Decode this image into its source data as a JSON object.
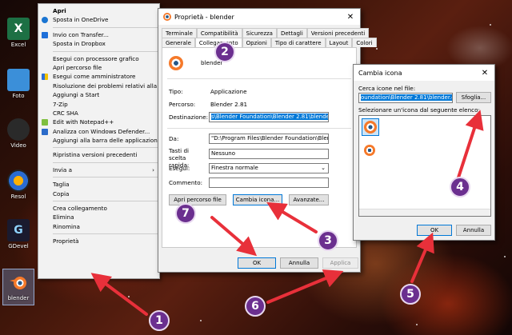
{
  "desktop": {
    "icons": [
      {
        "label": "Excel"
      },
      {
        "label": "Foto"
      },
      {
        "label": "Video"
      },
      {
        "label": "Resol"
      },
      {
        "label": "GDevel"
      },
      {
        "label": "blender"
      }
    ]
  },
  "context_menu": {
    "items": [
      {
        "label": "Apri"
      },
      {
        "label": "Sposta in OneDrive"
      },
      {
        "label": "Invio con Transfer..."
      },
      {
        "label": "Sposta in Dropbox"
      },
      {
        "label": "Esegui con processore grafico"
      },
      {
        "label": "Apri percorso file"
      },
      {
        "label": "Esegui come amministratore"
      },
      {
        "label": "Risoluzione dei problemi relativi alla co"
      },
      {
        "label": "Aggiungi a Start"
      },
      {
        "label": "7-Zip"
      },
      {
        "label": "CRC SHA"
      },
      {
        "label": "Edit with Notepad++"
      },
      {
        "label": "Analizza con Windows Defender..."
      },
      {
        "label": "Aggiungi alla barra delle applicazioni"
      },
      {
        "label": "Ripristina versioni precedenti"
      },
      {
        "label": "Invia a"
      },
      {
        "label": "Taglia"
      },
      {
        "label": "Copia"
      },
      {
        "label": "Crea collegamento"
      },
      {
        "label": "Elimina"
      },
      {
        "label": "Rinomina"
      },
      {
        "label": "Proprietà"
      }
    ]
  },
  "properties": {
    "title": "Proprietà - blender",
    "close_glyph": "✕",
    "tabs_row1": [
      "Terminale",
      "Compatibilità",
      "Sicurezza",
      "Dettagli",
      "Versioni precedenti"
    ],
    "tabs_row2": [
      "Generale",
      "Collegamento",
      "Opzioni",
      "Tipo di carattere",
      "Layout",
      "Colori"
    ],
    "name": "blender",
    "labels": {
      "tipo": "Tipo:",
      "percorso": "Percorso:",
      "destinazione": "Destinazione:",
      "da": "Da:",
      "tasti": "Tasti di scelta rapida:",
      "esegui": "Esegui:",
      "commento": "Commento:"
    },
    "values": {
      "tipo": "Applicazione",
      "percorso": "Blender 2.81",
      "destinazione": "s\\Blender Foundation\\Blender 2.81\\blender.exe\"",
      "da": "\"D:\\Program Files\\Blender Foundation\\Blender 2.",
      "tasti": "Nessuno",
      "esegui": "Finestra normale",
      "commento": ""
    },
    "buttons": {
      "apri_percorso": "Apri percorso file",
      "cambia_icona": "Cambia icona...",
      "avanzate": "Avanzate...",
      "ok": "OK",
      "annulla": "Annulla",
      "applica": "Applica"
    }
  },
  "change_icon": {
    "title": "Cambia icona",
    "close_glyph": "✕",
    "search_label": "Cerca icone nel file:",
    "file_value": "oundation\\Blender 2.81\\blender.exe",
    "browse": "Sfoglia...",
    "list_label": "Selezionare un'icona dal seguente elenco:",
    "ok": "OK",
    "annulla": "Annulla"
  },
  "annotations": [
    "1",
    "2",
    "3",
    "4",
    "5",
    "6",
    "7"
  ],
  "colors": {
    "badge": "#6b2f8f",
    "arrow": "#e8303a",
    "selection": "#0078d7"
  }
}
